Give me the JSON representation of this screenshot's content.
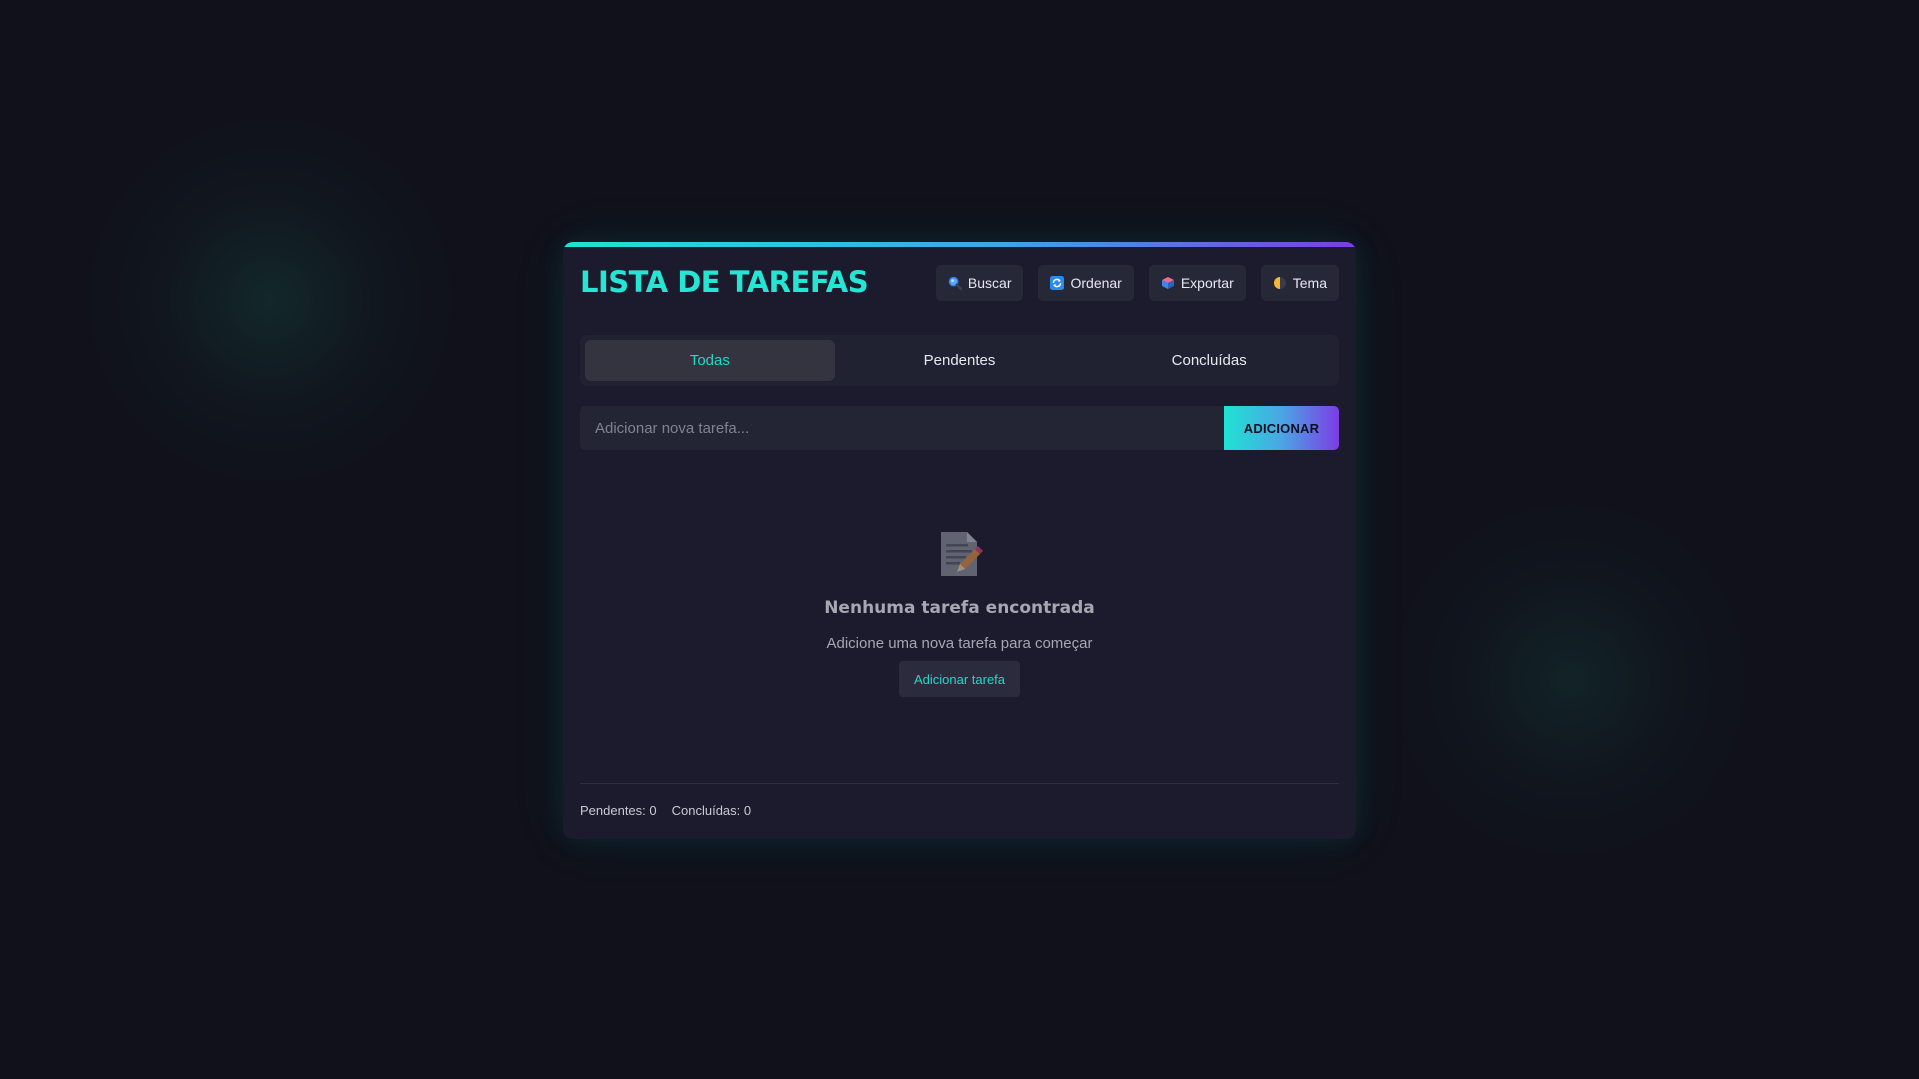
{
  "app": {
    "title": "LISTA DE TAREFAS"
  },
  "toolbar": {
    "buttons": [
      {
        "label": "Buscar",
        "icon": "magnifier-icon"
      },
      {
        "label": "Ordenar",
        "icon": "refresh-icon"
      },
      {
        "label": "Exportar",
        "icon": "package-icon"
      },
      {
        "label": "Tema",
        "icon": "half-moon-icon"
      }
    ]
  },
  "tabs": [
    {
      "label": "Todas",
      "active": true
    },
    {
      "label": "Pendentes",
      "active": false
    },
    {
      "label": "Concluídas",
      "active": false
    }
  ],
  "add_task": {
    "placeholder": "Adicionar nova tarefa...",
    "value": "",
    "button_label": "ADICIONAR"
  },
  "empty_state": {
    "icon": "memo-icon",
    "title": "Nenhuma tarefa encontrada",
    "subtitle": "Adicione uma nova tarefa para começar",
    "button_label": "Adicionar tarefa"
  },
  "footer": {
    "pending": "Pendentes: 0",
    "completed": "Concluídas: 0"
  },
  "colors": {
    "accent": "#25e6d4",
    "gradient_end": "#7d3ce4",
    "background": "#10111b",
    "card": "#1b1b2d"
  }
}
